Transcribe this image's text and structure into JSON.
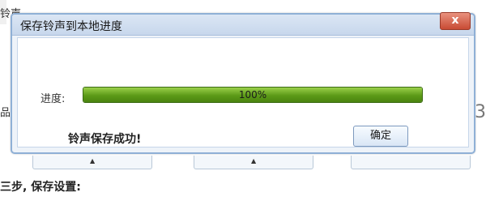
{
  "background": {
    "left_top_fragment": "铃声",
    "left_mid_fragment": "品",
    "right_mid_fragment": "3",
    "step_text": "三步, 保存设置:",
    "button_mark": "▲"
  },
  "dialog": {
    "title": "保存铃声到本地进度",
    "close_label": "x",
    "progress_label": "进度:",
    "progress_percent": 100,
    "progress_text": "100%",
    "success_message": "铃声保存成功!",
    "ok_label": "确定"
  }
}
